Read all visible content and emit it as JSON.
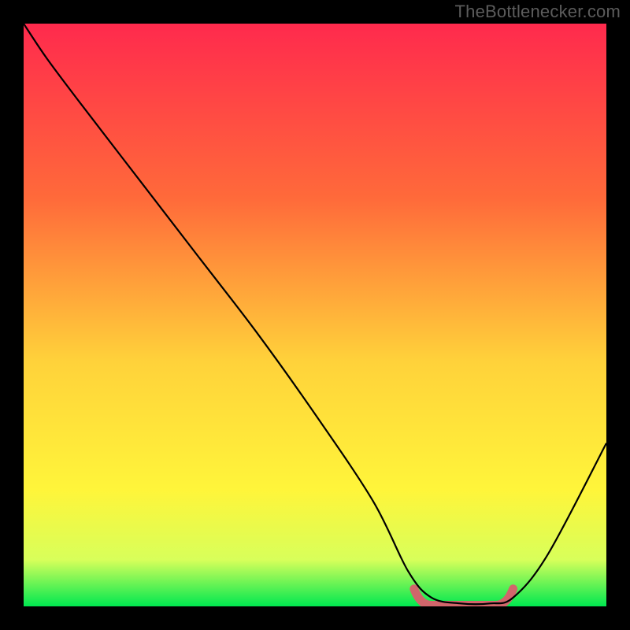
{
  "watermark": "TheBottleneсker.com",
  "colors": {
    "gradient_top": "#ff2a4d",
    "gradient_mid1": "#ff6a3a",
    "gradient_mid2": "#ffd23a",
    "gradient_mid3": "#fff53a",
    "gradient_mid4": "#d8ff5a",
    "gradient_bottom": "#00e850",
    "curve": "#000000",
    "highlight": "#d1666b",
    "frame": "#000000"
  },
  "chart_data": {
    "type": "line",
    "title": "",
    "xlabel": "",
    "ylabel": "",
    "xlim": [
      0,
      100
    ],
    "ylim": [
      0,
      100
    ],
    "x": [
      0,
      4,
      10,
      20,
      30,
      40,
      50,
      60,
      66,
      70,
      75,
      80,
      84,
      90,
      100
    ],
    "values": [
      100,
      94,
      86,
      73,
      60,
      47,
      33,
      18,
      6,
      1.5,
      0.5,
      0.5,
      1.5,
      9,
      28
    ],
    "highlight_band": {
      "x0": 67,
      "x1": 84,
      "min_y": 0.2
    },
    "notes": "V-shaped bottleneck curve over rainbow heat gradient; flat pink-highlighted optimal zone near x≈67–84."
  }
}
